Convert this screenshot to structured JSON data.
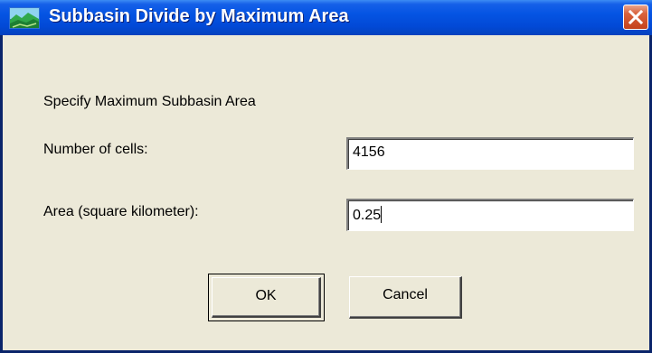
{
  "window": {
    "title": "Subbasin Divide by Maximum Area",
    "icon": "landscape-app-icon",
    "close_icon": "close-icon"
  },
  "form": {
    "heading": "Specify Maximum Subbasin Area",
    "cells_label": "Number of cells:",
    "cells_value": "4156",
    "area_label": "Area (square kilometer):",
    "area_value": "0.25"
  },
  "buttons": {
    "ok_label": "OK",
    "cancel_label": "Cancel"
  },
  "colors": {
    "titlebar": "#0554e3",
    "close": "#d9623c",
    "dialog_bg": "#ece9d8"
  }
}
